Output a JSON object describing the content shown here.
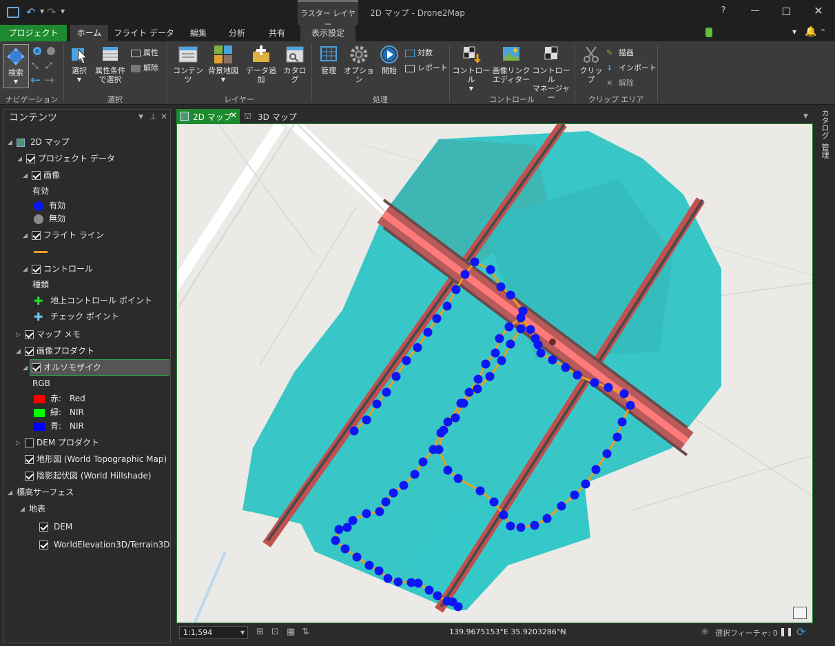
{
  "window": {
    "title": "2D マップ - Drone2Map",
    "context_tab": "ラスター レイヤー",
    "help": "?"
  },
  "tabs": [
    "プロジェクト",
    "ホーム",
    "フライト データ",
    "編集",
    "分析",
    "共有",
    "表示設定"
  ],
  "ribbon": {
    "navigation": {
      "label": "ナビゲーション",
      "explore": "検索"
    },
    "selection": {
      "label": "選択",
      "select": "選択",
      "select_by_attr": "属性条件\nで選択",
      "attributes": "属性",
      "clear": "解除"
    },
    "layer": {
      "label": "レイヤー",
      "contents": "コンテンツ",
      "basemap": "背景地図",
      "add_data": "データ追加",
      "catalog": "カタログ"
    },
    "processing": {
      "label": "処理",
      "manage": "管理",
      "options": "オプション",
      "start": "開始",
      "batch": "対数",
      "report": "レポート"
    },
    "control": {
      "label": "コントロール",
      "control": "コントロール",
      "image_link_editor": "画像リンク\nエディター",
      "control_manager": "コントロール\nマネージャー"
    },
    "clip": {
      "label": "クリップ エリア",
      "clip": "クリップ",
      "draw": "描画",
      "import": "インポート",
      "clear": "解除"
    }
  },
  "contents_panel": {
    "title": "コンテンツ",
    "items": {
      "map2d": "2D マップ",
      "project_data": "プロジェクト データ",
      "images": "画像",
      "valid_heading": "有効",
      "valid": "有効",
      "invalid": "無効",
      "flight_lines": "フライト ライン",
      "control": "コントロール",
      "kind_heading": "種類",
      "gcp": "地上コントロール ポイント",
      "check_point": "チェック ポイント",
      "map_notes": "マップ メモ",
      "image_products": "画像プロダクト",
      "orthomosaic": "オルソモザイク",
      "rgb": "RGB",
      "red_label": "赤:",
      "red_val": "Red",
      "green_label": "緑:",
      "green_val": "NIR",
      "blue_label": "青:",
      "blue_val": "NIR",
      "dem_products": "DEM プロダクト",
      "topo": "地形図 (World Topographic Map)",
      "hillshade": "陰影起伏図 (World Hillshade)",
      "elevation_surfaces": "標高サーフェス",
      "ground": "地表",
      "dem": "DEM",
      "world_elevation": "WorldElevation3D/Terrain3D"
    }
  },
  "view_tabs": {
    "tab2d": "2D マップ",
    "tab3d": "3D マップ"
  },
  "right_sidebar": {
    "catalog": "カタログ",
    "manage": "管理"
  },
  "status": {
    "scale": "1:1,594",
    "coords": "139.9675153°E 35.9203286°N",
    "selected": "選択フィーチャ: 0"
  },
  "colors": {
    "accent_green": "#1e8a2f",
    "flight_point": "#0b17f5",
    "flight_line": "#e8a020"
  }
}
